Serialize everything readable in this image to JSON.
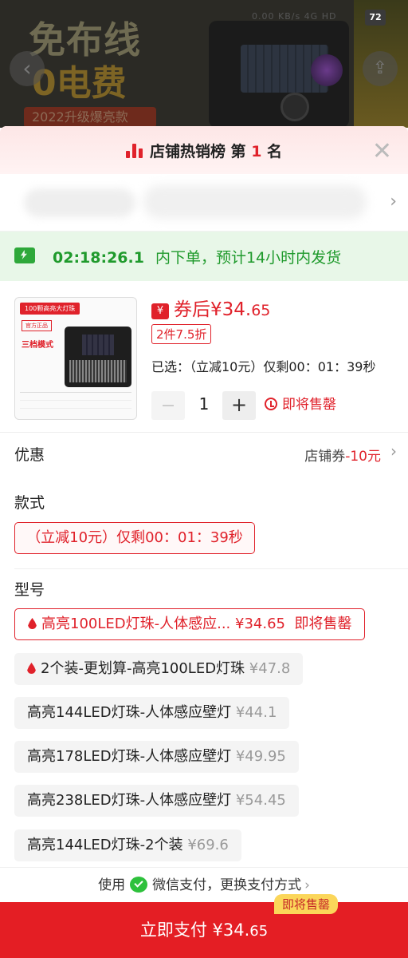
{
  "background": {
    "promo_line1": "免布线",
    "promo_line2": "0电费",
    "promo_line3": "2022升级爆亮款",
    "status_text": "0.00 KB/s 4G HD",
    "battery": "72"
  },
  "sheet": {
    "rank_text": "店铺热销榜 第",
    "rank_num": "1",
    "rank_suffix": "名",
    "shipping": {
      "countdown": "02:18:26.1",
      "message": "内下单，预计14小时内发货"
    },
    "product": {
      "thumb_tag": "100颗高亮大灯珠",
      "thumb_official": "官方正品",
      "thumb_mode": "三档模式",
      "price_label": "券后¥34.",
      "price_decimal": "65",
      "coupon_icon": "¥",
      "discount_tag": "2件7.5折",
      "selected_text": "已选：（立减10元）仅剩00：01：39秒",
      "quantity": "1",
      "selling_out": "即将售罄"
    },
    "discount_row": {
      "label": "优惠",
      "value_prefix": "店铺券",
      "value_red": "-10元"
    },
    "style": {
      "label": "款式",
      "chip": "（立减10元）仅剩00：01：39秒"
    },
    "model": {
      "label": "型号",
      "options": [
        {
          "name": "高亮100LED灯珠-人体感应...",
          "price": "¥34.65",
          "extra": "即将售罄"
        },
        {
          "name": "2个装-更划算-高亮100LED灯珠",
          "price": "¥47.8"
        },
        {
          "name": "高亮144LED灯珠-人体感应壁灯",
          "price": "¥44.1"
        },
        {
          "name": "高亮178LED灯珠-人体感应壁灯",
          "price": "¥49.95"
        },
        {
          "name": "高亮238LED灯珠-人体感应壁灯",
          "price": "¥54.45"
        },
        {
          "name": "高亮144LED灯珠-2个装",
          "price": "¥69.6"
        }
      ]
    },
    "pay_method": {
      "prefix": "使用",
      "wechat": "微信支付，更换支付方式"
    },
    "pay_button": {
      "label": "立即支付 ¥34.",
      "decimal": "65",
      "badge": "即将售罄"
    }
  },
  "colors": {
    "accent_red": "#e0222b",
    "ship_green": "#1f9a2c",
    "badge_yellow": "#fbd65a"
  }
}
